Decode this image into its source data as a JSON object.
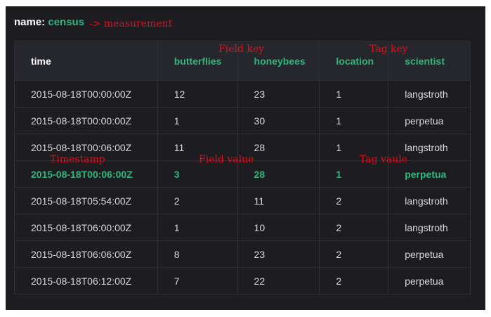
{
  "header": {
    "key": "name:",
    "value": "census"
  },
  "annotations": {
    "measurement": "-> measurement",
    "field_key": "Field key",
    "tag_key": "Tag key",
    "timestamp": "Timestamp",
    "field_value": "Field value",
    "tag_value": "Tag vaule"
  },
  "table": {
    "columns": [
      "time",
      "butterflies",
      "honeybees",
      "location",
      "scientist"
    ],
    "rows": [
      [
        "2015-08-18T00:00:00Z",
        "12",
        "23",
        "1",
        "langstroth"
      ],
      [
        "2015-08-18T00:00:00Z",
        "1",
        "30",
        "1",
        "perpetua"
      ],
      [
        "2015-08-18T00:06:00Z",
        "11",
        "28",
        "1",
        "langstroth"
      ],
      [
        "2015-08-18T00:06:00Z",
        "3",
        "28",
        "1",
        "perpetua"
      ],
      [
        "2015-08-18T05:54:00Z",
        "2",
        "11",
        "2",
        "langstroth"
      ],
      [
        "2015-08-18T06:00:00Z",
        "1",
        "10",
        "2",
        "langstroth"
      ],
      [
        "2015-08-18T06:06:00Z",
        "8",
        "23",
        "2",
        "perpetua"
      ],
      [
        "2015-08-18T06:12:00Z",
        "7",
        "22",
        "2",
        "perpetua"
      ]
    ],
    "highlighted_row": 3
  },
  "colors": {
    "background": "#1c1c21",
    "accent": "#2fb67c",
    "annotation": "#e0101a"
  }
}
